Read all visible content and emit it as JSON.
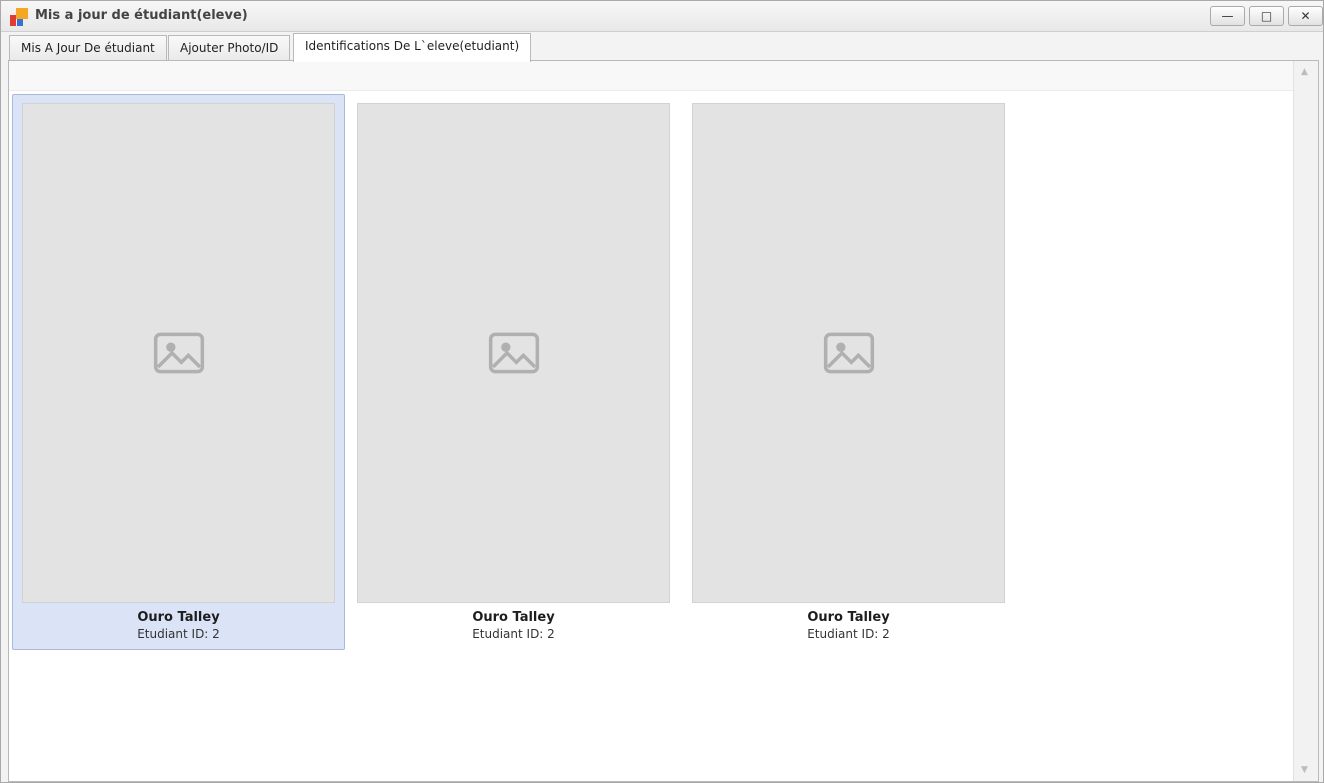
{
  "window": {
    "title": "Mis a jour de étudiant(eleve)",
    "buttons": {
      "minimize": "—",
      "maximize": "□",
      "close": "✕"
    }
  },
  "tabs": [
    {
      "label": "Mis A Jour De étudiant"
    },
    {
      "label": "Ajouter Photo/ID"
    },
    {
      "label": "Identifications De L`eleve(etudiant)"
    }
  ],
  "cards": [
    {
      "name": "Ouro Talley",
      "student_id": "Etudiant ID: 2"
    },
    {
      "name": "Ouro Talley",
      "student_id": "Etudiant ID: 2"
    },
    {
      "name": "Ouro Talley",
      "student_id": "Etudiant ID: 2"
    }
  ],
  "colors": {
    "selected_card_bg": "#dbe3f7",
    "selected_card_border": "#a9b8dd",
    "icon_red": "#e03c31",
    "icon_orange": "#f5a623",
    "icon_blue": "#3b6fd4"
  },
  "icons": {
    "app": "app-logo-icon",
    "photo_placeholder": "image-placeholder-icon"
  }
}
